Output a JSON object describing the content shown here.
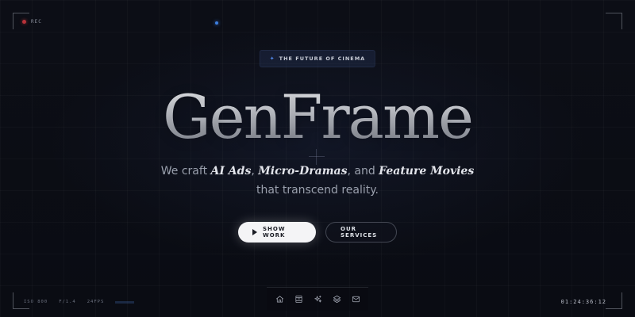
{
  "hud": {
    "rec_label": "REC",
    "stats": [
      "ISO 800",
      "F/1.4",
      "24FPS"
    ],
    "timecode": "01:24:36:12"
  },
  "hero": {
    "badge": "THE FUTURE OF CINEMA",
    "title": "GenFrame",
    "tagline": {
      "prefix": "We craft ",
      "item1": "AI Ads",
      "sep1": ", ",
      "item2": "Micro-Dramas",
      "sep2": ", and ",
      "item3": "Feature Movies",
      "line2": "that transcend reality."
    }
  },
  "actions": {
    "primary_label": "SHOW WORK",
    "secondary_label": "OUR SERVICES"
  },
  "dock": {
    "icons": [
      "home-icon",
      "film-icon",
      "sparkles-icon",
      "layers-icon",
      "mail-icon"
    ]
  },
  "colors": {
    "background": "#0b0d14",
    "accent_blue": "#3d7fe0",
    "rec_red": "#b8323a",
    "button_primary": "#f4f4f6"
  }
}
